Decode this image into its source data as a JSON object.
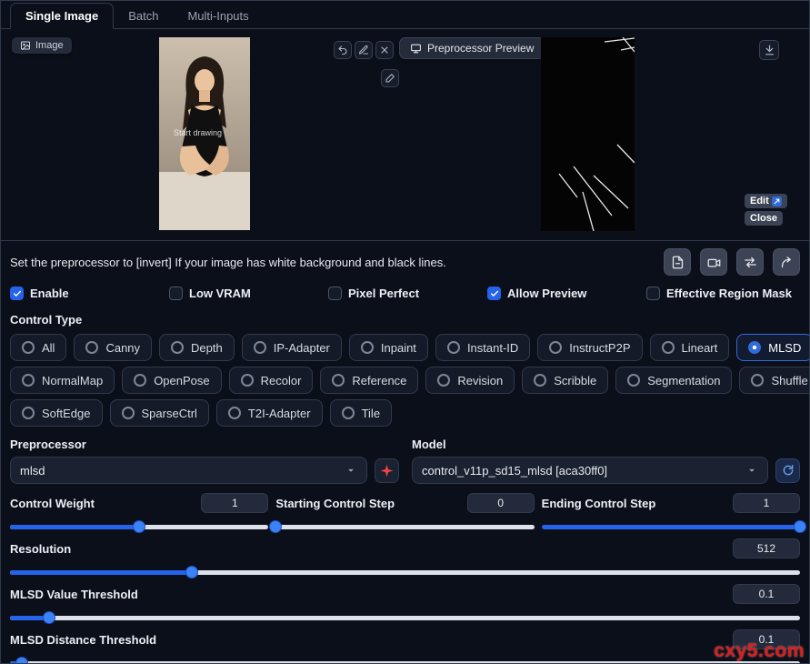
{
  "tabs": {
    "single_image": "Single Image",
    "batch": "Batch",
    "multi_inputs": "Multi-Inputs"
  },
  "image_area": {
    "image_chip": "Image",
    "start_drawing_hint": "Start drawing",
    "preprocessor_preview_button": "Preprocessor Preview",
    "edit_button": "Edit",
    "close_button": "Close"
  },
  "note": "Set the preprocessor to [invert] If your image has white background and black lines.",
  "checkboxes": {
    "enable": {
      "label": "Enable",
      "checked": true
    },
    "low_vram": {
      "label": "Low VRAM",
      "checked": false
    },
    "pixel_perfect": {
      "label": "Pixel Perfect",
      "checked": false
    },
    "allow_preview": {
      "label": "Allow Preview",
      "checked": true
    },
    "effective_region_mask": {
      "label": "Effective Region Mask",
      "checked": false
    }
  },
  "control_type": {
    "label": "Control Type",
    "selected": "MLSD",
    "options": [
      "All",
      "Canny",
      "Depth",
      "IP-Adapter",
      "Inpaint",
      "Instant-ID",
      "InstructP2P",
      "Lineart",
      "MLSD",
      "NormalMap",
      "OpenPose",
      "Recolor",
      "Reference",
      "Revision",
      "Scribble",
      "Segmentation",
      "Shuffle",
      "SoftEdge",
      "SparseCtrl",
      "T2I-Adapter",
      "Tile"
    ]
  },
  "preprocessor": {
    "label": "Preprocessor",
    "value": "mlsd"
  },
  "model": {
    "label": "Model",
    "value": "control_v11p_sd15_mlsd [aca30ff0]"
  },
  "sliders": {
    "control_weight": {
      "label": "Control Weight",
      "value": "1",
      "percent": 50
    },
    "starting_step": {
      "label": "Starting Control Step",
      "value": "0",
      "percent": 0
    },
    "ending_step": {
      "label": "Ending Control Step",
      "value": "1",
      "percent": 100
    },
    "resolution": {
      "label": "Resolution",
      "value": "512",
      "percent": 23
    },
    "mlsd_value": {
      "label": "MLSD Value Threshold",
      "value": "0.1",
      "percent": 5
    },
    "mlsd_distance": {
      "label": "MLSD Distance Threshold",
      "value": "0.1",
      "percent": 1.5
    }
  },
  "watermark": "cxy5.com"
}
